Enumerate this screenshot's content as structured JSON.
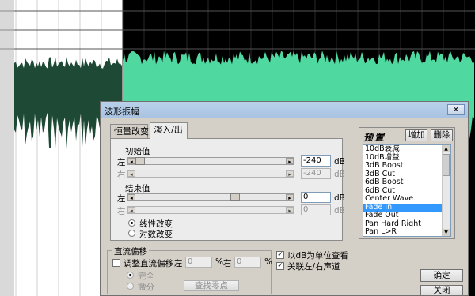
{
  "colors": {
    "wave_left": "#1e4a35",
    "wave_right": "#4fd8a0",
    "grid_bg": "#000000",
    "left_bg": "#ffffff"
  },
  "dialog": {
    "title": "波形振幅",
    "close_glyph": "✕",
    "tabs": [
      {
        "label": "恒量改变",
        "active": false
      },
      {
        "label": "淡入/出",
        "active": true
      }
    ],
    "initial": {
      "heading": "初始值",
      "left_label": "左",
      "right_label": "右",
      "left_value": "-240",
      "right_value": "-240",
      "unit": "dB"
    },
    "final": {
      "heading": "结束值",
      "left_label": "左",
      "right_label": "右",
      "left_value": "0",
      "right_value": "0",
      "unit": "dB"
    },
    "mode": {
      "linear": "线性改变",
      "log": "对数改变",
      "selected": "linear"
    },
    "dc": {
      "group_title": "直流偏移",
      "adjust_label": "调整直流偏移",
      "left_label": "左",
      "left_value": "0",
      "right_label": "右",
      "right_value": "0",
      "percent": "%",
      "full": "完全",
      "partial": "微分",
      "find_zero": "查找零点"
    },
    "options": {
      "db_units": "以dB为单位查看",
      "link_channels": "关联左/右声道"
    },
    "presets": {
      "title": "预置",
      "add": "增加",
      "delete": "删除",
      "items": [
        "10dB衰减",
        "10dB增益",
        "3dB Boost",
        "3dB Cut",
        "6dB Boost",
        "6dB Cut",
        "Center Wave",
        "Fade In",
        "Fade Out",
        "Pan Hard Right",
        "Pan L>R"
      ],
      "selected_index": 7
    },
    "ok": "确定",
    "close": "关闭"
  }
}
